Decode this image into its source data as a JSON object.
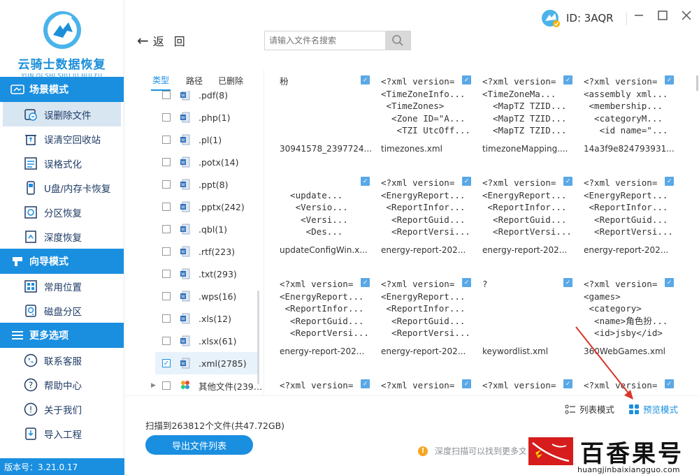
{
  "app": {
    "name": "云骑士数据恢复",
    "pinyin": "YUN QI SHI SHU JU HUI FU",
    "version": "版本号：3.21.0.17"
  },
  "sidebar": {
    "sections": [
      {
        "title": "场景模式",
        "icon": "scene-icon",
        "items": [
          {
            "label": "误删除文件",
            "icon": "deleted-file-icon",
            "active": true
          },
          {
            "label": "误清空回收站",
            "icon": "recycle-bin-icon"
          },
          {
            "label": "误格式化",
            "icon": "format-icon"
          },
          {
            "label": "U盘/内存卡恢复",
            "icon": "usb-icon"
          },
          {
            "label": "分区恢复",
            "icon": "partition-icon"
          },
          {
            "label": "深度恢复",
            "icon": "deep-recover-icon"
          }
        ]
      },
      {
        "title": "向导模式",
        "icon": "wizard-icon",
        "items": [
          {
            "label": "常用位置",
            "icon": "windows-icon"
          },
          {
            "label": "磁盘分区",
            "icon": "disk-icon"
          }
        ]
      },
      {
        "title": "更多选项",
        "icon": "menu-icon",
        "items": [
          {
            "label": "联系客服",
            "icon": "phone-icon"
          },
          {
            "label": "帮助中心",
            "icon": "help-icon"
          },
          {
            "label": "关于我们",
            "icon": "info-icon"
          },
          {
            "label": "导入工程",
            "icon": "import-icon"
          }
        ]
      }
    ]
  },
  "header": {
    "back_label": "返回",
    "search_placeholder": "请输入文件名搜索",
    "user_id": "ID: 3AQR"
  },
  "filter": {
    "tabs": [
      "类型",
      "路径",
      "已删除"
    ],
    "items": [
      {
        "label": ".pdf(8)",
        "checked": false
      },
      {
        "label": ".php(1)",
        "checked": false
      },
      {
        "label": ".pl(1)",
        "checked": false
      },
      {
        "label": ".potx(14)",
        "checked": false
      },
      {
        "label": ".ppt(8)",
        "checked": false
      },
      {
        "label": ".pptx(242)",
        "checked": false
      },
      {
        "label": ".qbl(1)",
        "checked": false
      },
      {
        "label": ".rtf(223)",
        "checked": false
      },
      {
        "label": ".txt(293)",
        "checked": false
      },
      {
        "label": ".wps(16)",
        "checked": false
      },
      {
        "label": ".xls(12)",
        "checked": false
      },
      {
        "label": ".xlsx(61)",
        "checked": false
      },
      {
        "label": ".xml(2785)",
        "checked": true
      },
      {
        "label": "其他文件(239…",
        "checked": false,
        "expandable": true
      }
    ]
  },
  "grid": {
    "files": [
      {
        "preview": "秎",
        "name": "30941578_2397724..."
      },
      {
        "preview": "<?xml version=\n<TimeZoneInfo...\n <TimeZones>\n  <Zone ID=\"A...\n   <TZI UtcOff...",
        "name": "timezones.xml"
      },
      {
        "preview": "<?xml version=\n<TimeZoneMa...\n  <MapTZ TZID...\n  <MapTZ TZID...\n  <MapTZ TZID...",
        "name": "timezoneMapping...."
      },
      {
        "preview": "<?xml version=\n<assembly xml...\n <membership...\n  <categoryM...\n   <id name=\"...",
        "name": "14a3f9e824793931..."
      },
      {
        "preview": "\n  <update...\n   <Versio...\n    <Versi...\n     <Des...",
        "name": "updateConfigWin.x..."
      },
      {
        "preview": "<?xml version=\n<EnergyReport...\n <ReportInfor...\n  <ReportGuid...\n  <ReportVersi...",
        "name": "energy-report-202..."
      },
      {
        "preview": "<?xml version=\n<EnergyReport...\n <ReportInfor...\n  <ReportGuid...\n  <ReportVersi...",
        "name": "energy-report-202..."
      },
      {
        "preview": "<?xml version=\n<EnergyReport...\n <ReportInfor...\n  <ReportGuid...\n  <ReportVersi...",
        "name": "energy-report-202..."
      },
      {
        "preview": "<?xml version=\n<EnergyReport...\n <ReportInfor...\n  <ReportGuid...\n  <ReportVersi...",
        "name": "energy-report-202..."
      },
      {
        "preview": "<?xml version=\n<EnergyReport...\n <ReportInfor...\n  <ReportGuid...\n  <ReportVersi...",
        "name": "energy-report-202..."
      },
      {
        "preview": "?",
        "name": "keywordlist.xml"
      },
      {
        "preview": "<?xml version=\n<games>\n <category>\n  <name>角色扮...\n  <id>jsby</id>",
        "name": "360WebGames.xml"
      },
      {
        "preview": "<?xml version=",
        "name": ""
      },
      {
        "preview": "<?xml version=",
        "name": ""
      },
      {
        "preview": "<?xml version=",
        "name": ""
      },
      {
        "preview": "<?xml version=",
        "name": ""
      }
    ]
  },
  "view_toggle": {
    "list_label": "列表模式",
    "preview_label": "预览模式",
    "active": "preview"
  },
  "footer": {
    "scan_info": "扫描到263812个文件(共47.72GB)",
    "export_label": "导出文件列表",
    "tip": "深度扫描可以找到更多文"
  },
  "watermark": {
    "text": "百香果号",
    "url": "huangjinbaixiangguo.com"
  },
  "colors": {
    "primary": "#1a8fe0",
    "active_bg": "#d8e6f2",
    "annotation_arrow": "#d9362b"
  }
}
